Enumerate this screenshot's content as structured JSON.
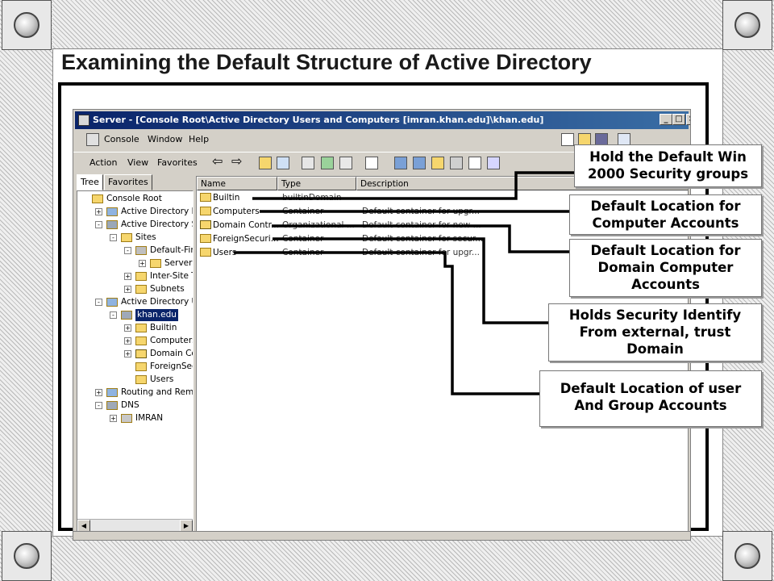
{
  "slide_title": "Examining the Default Structure of Active Directory",
  "window": {
    "title": "Server - [Console Root\\Active Directory Users and Computers [imran.khan.edu]\\khan.edu]",
    "controls": {
      "minimize": "_",
      "maximize": "□",
      "close": "×"
    }
  },
  "menubar": {
    "items": [
      "Console",
      "Window",
      "Help"
    ]
  },
  "action_bar": {
    "items": [
      "Action",
      "View",
      "Favorites"
    ]
  },
  "tabs": [
    "Tree",
    "Favorites"
  ],
  "tree": [
    {
      "label": "Console Root",
      "depth": 0,
      "expander": "",
      "icon": "folder"
    },
    {
      "label": "Active Directory Dom",
      "depth": 1,
      "expander": "+",
      "icon": "ad-domains-icon"
    },
    {
      "label": "Active Directory Site",
      "depth": 1,
      "expander": "-",
      "icon": "ad-sites-icon"
    },
    {
      "label": "Sites",
      "depth": 2,
      "expander": "-",
      "icon": "folder"
    },
    {
      "label": "Default-First",
      "depth": 3,
      "expander": "-",
      "icon": "site-icon"
    },
    {
      "label": "Servers",
      "depth": 4,
      "expander": "+",
      "icon": "folder"
    },
    {
      "label": "Inter-Site Tra",
      "depth": 3,
      "expander": "+",
      "icon": "folder"
    },
    {
      "label": "Subnets",
      "depth": 3,
      "expander": "+",
      "icon": "folder"
    },
    {
      "label": "Active Directory Use",
      "depth": 1,
      "expander": "-",
      "icon": "ad-users-icon"
    },
    {
      "label": "khan.edu",
      "depth": 2,
      "expander": "-",
      "icon": "domain-icon",
      "selected": true
    },
    {
      "label": "Builtin",
      "depth": 3,
      "expander": "+",
      "icon": "folder"
    },
    {
      "label": "Computers",
      "depth": 3,
      "expander": "+",
      "icon": "folder"
    },
    {
      "label": "Domain Cont",
      "depth": 3,
      "expander": "+",
      "icon": "ou-folder"
    },
    {
      "label": "ForeignSecur",
      "depth": 3,
      "expander": "",
      "icon": "folder"
    },
    {
      "label": "Users",
      "depth": 3,
      "expander": "",
      "icon": "folder"
    },
    {
      "label": "Routing and Remote",
      "depth": 1,
      "expander": "+",
      "icon": "routing-icon"
    },
    {
      "label": "DNS",
      "depth": 1,
      "expander": "-",
      "icon": "dns-icon"
    },
    {
      "label": "IMRAN",
      "depth": 2,
      "expander": "+",
      "icon": "server-icon"
    }
  ],
  "list": {
    "columns": [
      "Name",
      "Type",
      "Description"
    ],
    "rows": [
      {
        "name": "Builtin",
        "type": "builtinDomain",
        "description": "",
        "icon": "folder"
      },
      {
        "name": "Computers",
        "type": "Container",
        "description": "Default container for upgr...",
        "icon": "folder"
      },
      {
        "name": "Domain Contr...",
        "type": "Organizational ...",
        "description": "Default container for new ...",
        "icon": "ou-folder"
      },
      {
        "name": "ForeignSecuri...",
        "type": "Container",
        "description": "Default container for secur...",
        "icon": "folder"
      },
      {
        "name": "Users",
        "type": "Container",
        "description": "Default container for upgr...",
        "icon": "folder"
      }
    ]
  },
  "callouts": [
    {
      "id": "builtin",
      "text": "Hold the Default Win\n2000 Security groups"
    },
    {
      "id": "computers",
      "text": "Default Location for\nComputer Accounts"
    },
    {
      "id": "domain-controllers",
      "text": "Default Location for\nDomain Computer\nAccounts"
    },
    {
      "id": "foreign-security",
      "text": "Holds Security Identify\nFrom external, trust\nDomain"
    },
    {
      "id": "users",
      "text": "Default Location of user\nAnd Group Accounts"
    }
  ],
  "colors": {
    "titlebar_start": "#0a246a",
    "titlebar_end": "#3a6ea5",
    "window_face": "#d4d0c8",
    "folder": "#f6d66d",
    "selection": "#0a246a"
  }
}
